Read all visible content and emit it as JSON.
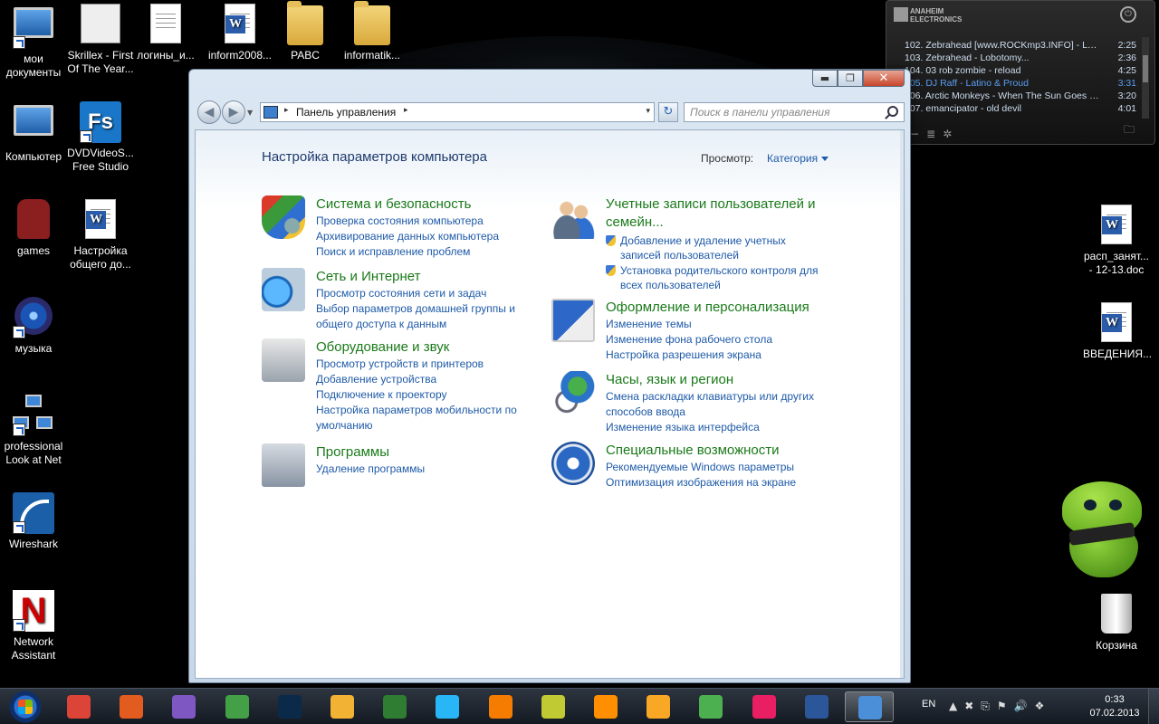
{
  "desktop": {
    "icons_left": [
      {
        "label": "мои документы",
        "kind": "monitor",
        "shortcut": true
      },
      {
        "label": "Skrillex - First Of The Year...",
        "kind": "thumb",
        "shortcut": false
      },
      {
        "label": "логины_и...",
        "kind": "doc",
        "shortcut": false
      },
      {
        "label": "inform2008...",
        "kind": "word",
        "shortcut": false
      },
      {
        "label": "PABC",
        "kind": "folder",
        "shortcut": false
      },
      {
        "label": "informatik...",
        "kind": "folder",
        "shortcut": false
      },
      {
        "label": "Компьютер",
        "kind": "computer",
        "shortcut": false
      },
      {
        "label": "DVDVideoS... Free Studio",
        "kind": "fs",
        "shortcut": true
      },
      {
        "label": "games",
        "kind": "chair",
        "shortcut": false
      },
      {
        "label": "Настройка общего до...",
        "kind": "word",
        "shortcut": false
      },
      {
        "label": "музыка",
        "kind": "music",
        "shortcut": true
      },
      {
        "label": "professional Look at Net",
        "kind": "net",
        "shortcut": true
      },
      {
        "label": "Wireshark",
        "kind": "shark",
        "shortcut": true
      },
      {
        "label": "Network Assistant",
        "kind": "netassist",
        "shortcut": true
      }
    ],
    "icons_right": [
      {
        "label": "расп_занят... - 12-13.doc",
        "kind": "word"
      },
      {
        "label": "ВВЕДЕНИЯ...",
        "kind": "word"
      },
      {
        "label": "Корзина",
        "kind": "bin"
      }
    ]
  },
  "player": {
    "brand_line1": "ANAHEIM",
    "brand_line2": "ELECTRONICS",
    "power_glyph": "⏻",
    "tracks": [
      {
        "title": "102. Zebrahead [www.ROCKmp3.INFO] - Lon...",
        "time": "2:25",
        "highlight": false
      },
      {
        "title": "103. Zebrahead - Lobotomy...",
        "time": "2:36",
        "highlight": false
      },
      {
        "title": "104. 03 rob zombie - reload",
        "time": "4:25",
        "highlight": false
      },
      {
        "title": "105. DJ Raff - Latino & Proud",
        "time": "3:31",
        "highlight": true
      },
      {
        "title": "106. Arctic Monkeys - When The Sun Goes D...",
        "time": "3:20",
        "highlight": false
      },
      {
        "title": "107. emancipator - old devil",
        "time": "4:01",
        "highlight": false
      }
    ],
    "controls": [
      "+",
      "−",
      "≣",
      "✲"
    ],
    "folder_glyph": "🗀"
  },
  "window": {
    "controls": {
      "minimize": "▬",
      "maximize": "❐",
      "close": "✕"
    },
    "address": {
      "crumb": "Панель управления",
      "separator": "▸",
      "dropdown": "▾"
    },
    "refresh_glyph": "↻",
    "search_placeholder": "Поиск в панели управления",
    "page_title": "Настройка параметров компьютера",
    "view_label": "Просмотр:",
    "view_value": "Категория",
    "categories": [
      {
        "title": "Система и безопасность",
        "icon": "shield-icon",
        "links": [
          "Проверка состояния компьютера",
          "Архивирование данных компьютера",
          "Поиск и исправление проблем"
        ]
      },
      {
        "title": "Сеть и Интернет",
        "icon": "network-icon",
        "links": [
          "Просмотр состояния сети и задач",
          "Выбор параметров домашней группы и общего доступа к данным"
        ]
      },
      {
        "title": "Оборудование и звук",
        "icon": "printer-icon",
        "links": [
          "Просмотр устройств и принтеров",
          "Добавление устройства",
          "Подключение к проектору",
          "Настройка параметров мобильности по умолчанию"
        ]
      },
      {
        "title": "Программы",
        "icon": "programs-icon",
        "links": [
          "Удаление программы"
        ]
      },
      {
        "title": "Учетные записи пользователей и семейн...",
        "icon": "users-icon",
        "links": [
          "Добавление и удаление учетных записей пользователей",
          "Установка родительского контроля для всех пользователей"
        ]
      },
      {
        "title": "Оформление и персонализация",
        "icon": "appearance-icon",
        "links": [
          "Изменение темы",
          "Изменение фона рабочего стола",
          "Настройка разрешения экрана"
        ]
      },
      {
        "title": "Часы, язык и регион",
        "icon": "clock-globe-icon",
        "links": [
          "Смена раскладки клавиатуры или других способов ввода",
          "Изменение языка интерфейса"
        ]
      },
      {
        "title": "Специальные возможности",
        "icon": "accessibility-icon",
        "links": [
          "Рекомендуемые Windows параметры",
          "Оптимизация изображения на экране"
        ]
      }
    ]
  },
  "taskbar": {
    "apps": [
      {
        "name": "chrome",
        "color": "#db4437",
        "active": false
      },
      {
        "name": "burning",
        "color": "#e25b1f",
        "active": false
      },
      {
        "name": "visual-studio",
        "color": "#7e57c2",
        "active": false
      },
      {
        "name": "navigator",
        "color": "#43a047",
        "active": false
      },
      {
        "name": "photoshop",
        "color": "#0b2a4a",
        "active": false
      },
      {
        "name": "winamp",
        "color": "#f2b233",
        "active": false
      },
      {
        "name": "speed-app",
        "color": "#2e7d32",
        "active": false
      },
      {
        "name": "music-app",
        "color": "#29b6f6",
        "active": false
      },
      {
        "name": "sublime",
        "color": "#f57c00",
        "active": false
      },
      {
        "name": "robot-app",
        "color": "#c0ca33",
        "active": false
      },
      {
        "name": "vlc",
        "color": "#ff8f00",
        "active": false
      },
      {
        "name": "hotspot",
        "color": "#f9a825",
        "active": false
      },
      {
        "name": "utorrent",
        "color": "#4caf50",
        "active": false
      },
      {
        "name": "pink-app",
        "color": "#e91e63",
        "active": false
      },
      {
        "name": "word",
        "color": "#2b579a",
        "active": false
      },
      {
        "name": "control-panel",
        "color": "#4a8fd8",
        "active": true
      }
    ],
    "lang": "EN",
    "tray_icons": [
      "▲",
      "✖",
      "⎘",
      "⚑",
      "🔊",
      "❖"
    ],
    "time": "0:33",
    "date": "07.02.2013"
  }
}
